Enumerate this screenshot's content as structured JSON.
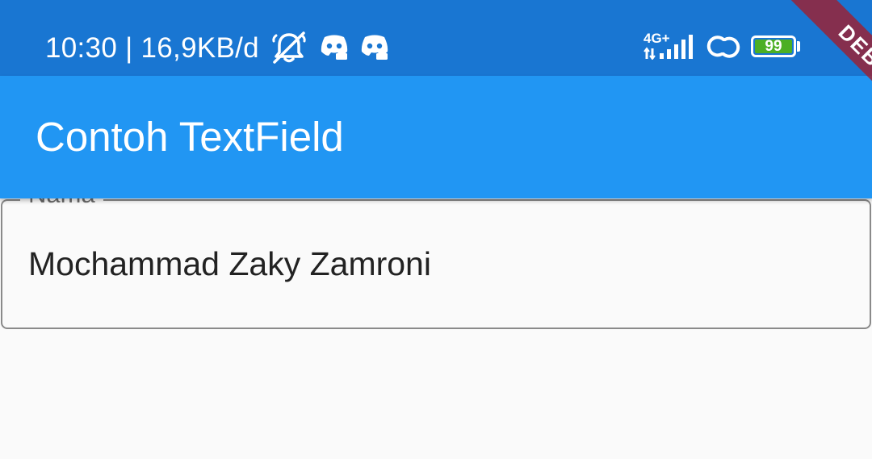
{
  "status_bar": {
    "time_and_speed": "10:30 | 16,9KB/d",
    "network_type": "4G+",
    "battery_level": "99",
    "battery_fraction": 0.99,
    "icons": [
      "mute-notifications-icon",
      "discord-icon",
      "discord-icon",
      "signal-icon",
      "hotspot-icon",
      "battery-icon"
    ],
    "background_color": "#1976d2"
  },
  "app_bar": {
    "title": "Contoh TextField",
    "background_color": "#2196f3"
  },
  "text_field": {
    "label": "Nama",
    "value": "Mochammad Zaky Zamroni"
  },
  "debug_banner": {
    "text": "DEBUG"
  }
}
